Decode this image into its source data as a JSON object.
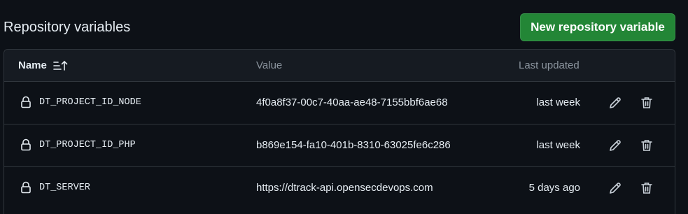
{
  "header": {
    "title": "Repository variables",
    "new_button_label": "New repository variable"
  },
  "table": {
    "columns": {
      "name": "Name",
      "value": "Value",
      "last_updated": "Last updated"
    },
    "rows": [
      {
        "name": "DT_PROJECT_ID_NODE",
        "value": "4f0a8f37-00c7-40aa-ae48-7155bbf6ae68",
        "last_updated": "last week"
      },
      {
        "name": "DT_PROJECT_ID_PHP",
        "value": "b869e154-fa10-401b-8310-63025fe6c286",
        "last_updated": "last week"
      },
      {
        "name": "DT_SERVER",
        "value": "https://dtrack-api.opensecdevops.com",
        "last_updated": "5 days ago"
      }
    ]
  },
  "icons": {
    "lock": "lock-icon",
    "edit": "pencil-icon",
    "delete": "trash-icon",
    "sort": "sort-ascending-icon"
  },
  "colors": {
    "background": "#0d1117",
    "header_bg": "#161b22",
    "border": "#30363d",
    "primary_button": "#238636",
    "muted_text": "#8b949e",
    "text": "#e6edf3"
  }
}
